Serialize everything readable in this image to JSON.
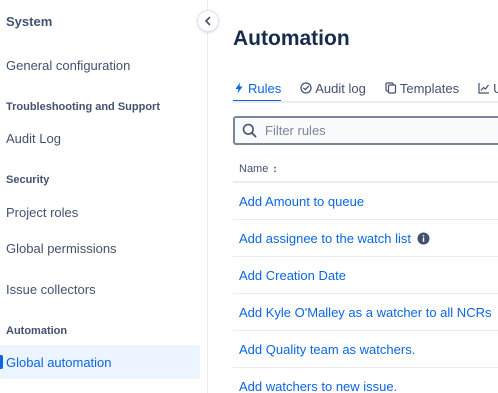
{
  "sidebar": {
    "title": "System",
    "items": [
      {
        "label": "General configuration"
      },
      {
        "label": "Audit Log"
      },
      {
        "label": "Project roles"
      },
      {
        "label": "Global permissions"
      },
      {
        "label": "Issue collectors"
      },
      {
        "label": "Global automation"
      }
    ],
    "sections": [
      {
        "label": "Troubleshooting and Support"
      },
      {
        "label": "Security"
      },
      {
        "label": "Automation"
      }
    ]
  },
  "main": {
    "title": "Automation",
    "tabs": [
      {
        "label": "Rules",
        "icon": "bolt-icon"
      },
      {
        "label": "Audit log",
        "icon": "check-circle-icon"
      },
      {
        "label": "Templates",
        "icon": "copy-icon"
      },
      {
        "label": "U",
        "icon": "chart-icon"
      }
    ],
    "search": {
      "placeholder": "Filter rules",
      "value": ""
    },
    "table": {
      "column_name": "Name",
      "rows": [
        {
          "name": "Add Amount to queue"
        },
        {
          "name": "Add assignee to the watch list"
        },
        {
          "name": "Add Creation Date"
        },
        {
          "name": "Add Kyle O'Malley as a watcher to all NCRs"
        },
        {
          "name": "Add Quality team as watchers."
        },
        {
          "name": "Add watchers to new issue."
        }
      ]
    }
  },
  "colors": {
    "accent": "#0c66e4",
    "text": "#172b4d",
    "subtle": "#42526e",
    "selected_bg": "#ebf4ff"
  }
}
